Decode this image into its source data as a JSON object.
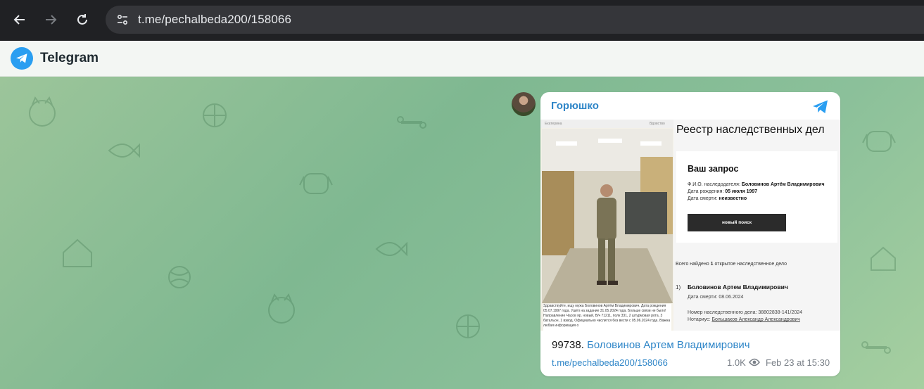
{
  "browser": {
    "url": "t.me/pechalbeda200/158066",
    "icons": [
      "back-arrow-icon",
      "forward-arrow-icon",
      "reload-icon",
      "site-info-icon"
    ]
  },
  "telegram": {
    "app_title": "Telegram",
    "brand_color": "#2a9ef1"
  },
  "message": {
    "author": "Горюшко",
    "text_number": "99738.",
    "text_link": "Боловинов Артем Владимирович",
    "post_link": "t.me/pechalbeda200/158066",
    "views": "1.0K",
    "date": "Feb 23 at 15:30",
    "link_color": "#2f86c8"
  },
  "media": {
    "photo_header_left": "Екатерина",
    "photo_header_right": "Вдовство",
    "photo_caption": "Здравствуйте, ищу мужа Боловинов Артём Владимирович. Дата рождения 05.07.1997 года. Ушёл на задание 31.05.2024 года. Больше связи не было! Направление Часов яр. новый, В/ч 71211, полк 331, 2 штурмовая рота, 3 батальон, 1 взвод. Официально числится без вести с 05.06.2024 года. Важна любая информация о",
    "registry_title": "Реестр наследственных дел",
    "query_title": "Ваш запрос",
    "fio_label": "Ф.И.О. наследодателя:",
    "fio_value": "Боловинов Артём Владимирович",
    "birth_label": "Дата рождения:",
    "birth_value": "05 июля 1997",
    "death_label": "Дата смерти:",
    "death_value": "неизвестно",
    "new_search": "новый поиск",
    "found_prefix": "Всего найдено",
    "found_count": "1",
    "found_suffix": "открытое наследственное дело",
    "result_number": "1)",
    "result_name": "Боловинов Артем Владимирович",
    "result_death": "Дата смерти: 08.06.2024",
    "result_case": "Номер наследственного дела: 38802838-141/2024",
    "result_notary_label": "Нотариус:",
    "result_notary": "Большаков Александр Александрович"
  }
}
